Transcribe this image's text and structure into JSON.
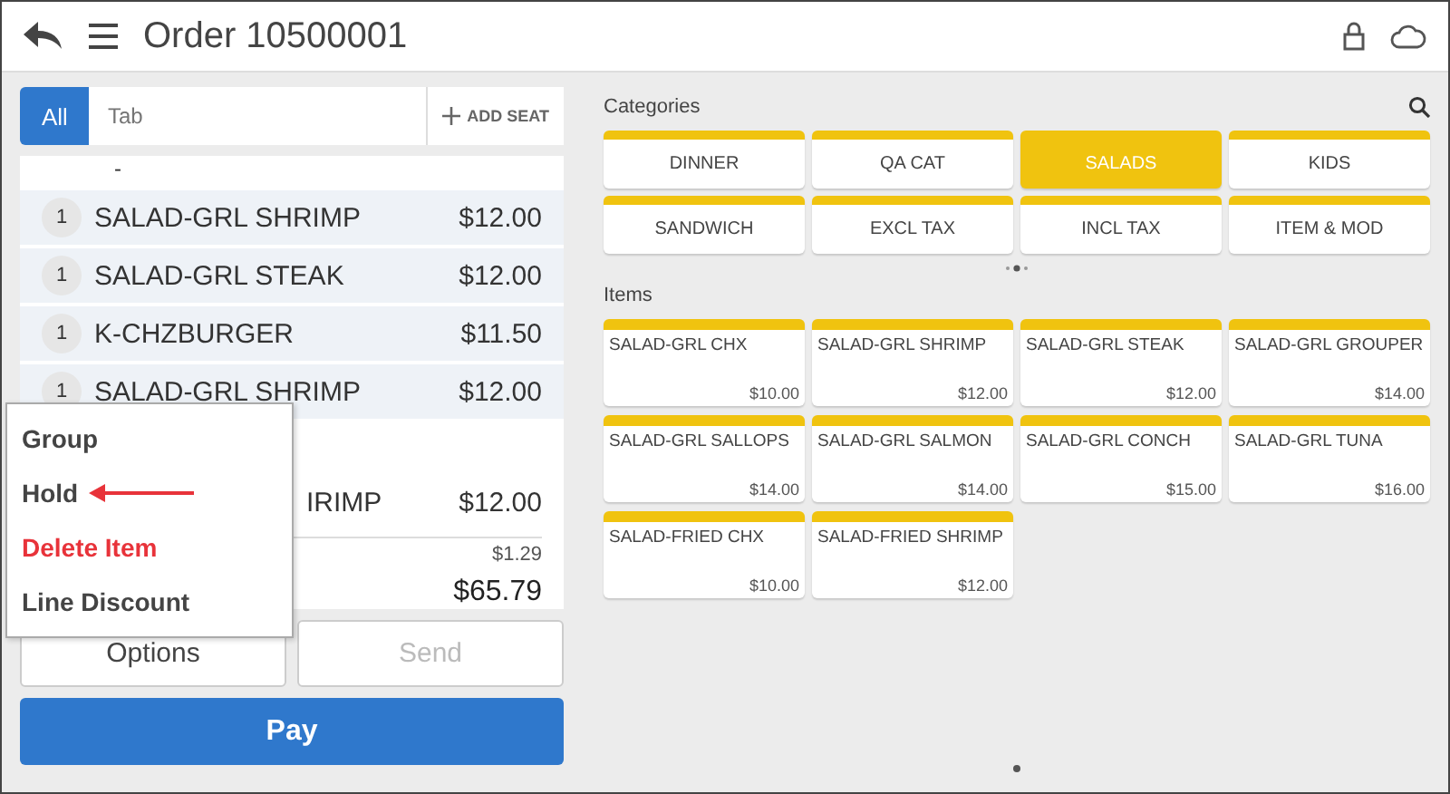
{
  "header": {
    "title": "Order 10500001"
  },
  "order_tabs": [
    {
      "label": "All",
      "selected": true
    }
  ],
  "tab_field": {
    "placeholder": "Tab"
  },
  "add_seat": {
    "label": "ADD SEAT"
  },
  "order_lines": [
    {
      "kind": "partial",
      "name": "-"
    },
    {
      "kind": "line",
      "qty": "1",
      "name": "SALAD-GRL SHRIMP",
      "price": "$12.00"
    },
    {
      "kind": "line",
      "qty": "1",
      "name": "SALAD-GRL STEAK",
      "price": "$12.00"
    },
    {
      "kind": "line",
      "qty": "1",
      "name": "K-CHZBURGER",
      "price": "$11.50"
    },
    {
      "kind": "line",
      "qty": "1",
      "name": "SALAD-GRL SHRIMP",
      "price": "$12.00"
    },
    {
      "kind": "blank"
    },
    {
      "kind": "covered",
      "name": "IRIMP",
      "price": "$12.00"
    }
  ],
  "tax": "$1.29",
  "total": "$65.79",
  "context_menu": [
    {
      "label": "Group",
      "danger": false,
      "pointed": false
    },
    {
      "label": "Hold",
      "danger": false,
      "pointed": true
    },
    {
      "label": "Delete Item",
      "danger": true,
      "pointed": false
    },
    {
      "label": "Line Discount",
      "danger": false,
      "pointed": false
    }
  ],
  "actions": [
    {
      "label": "Options",
      "disabled": false
    },
    {
      "label": "Send",
      "disabled": true
    }
  ],
  "pay": {
    "label": "Pay"
  },
  "categories": {
    "title": "Categories",
    "items": [
      {
        "label": "DINNER",
        "selected": false
      },
      {
        "label": "QA CAT",
        "selected": false
      },
      {
        "label": "SALADS",
        "selected": true
      },
      {
        "label": "KIDS",
        "selected": false
      },
      {
        "label": "SANDWICH",
        "selected": false
      },
      {
        "label": "EXCL TAX",
        "selected": false
      },
      {
        "label": "INCL TAX",
        "selected": false
      },
      {
        "label": "ITEM & MOD",
        "selected": false
      }
    ]
  },
  "items": {
    "title": "Items",
    "products": [
      {
        "name": "SALAD-GRL CHX",
        "price": "$10.00"
      },
      {
        "name": "SALAD-GRL SHRIMP",
        "price": "$12.00"
      },
      {
        "name": "SALAD-GRL STEAK",
        "price": "$12.00"
      },
      {
        "name": "SALAD-GRL GROUPER",
        "price": "$14.00"
      },
      {
        "name": "SALAD-GRL SALLOPS",
        "price": "$14.00"
      },
      {
        "name": "SALAD-GRL SALMON",
        "price": "$14.00"
      },
      {
        "name": "SALAD-GRL CONCH",
        "price": "$15.00"
      },
      {
        "name": "SALAD-GRL TUNA",
        "price": "$16.00"
      },
      {
        "name": "SALAD-FRIED CHX",
        "price": "$10.00"
      },
      {
        "name": "SALAD-FRIED SHRIMP",
        "price": "$12.00"
      }
    ]
  }
}
